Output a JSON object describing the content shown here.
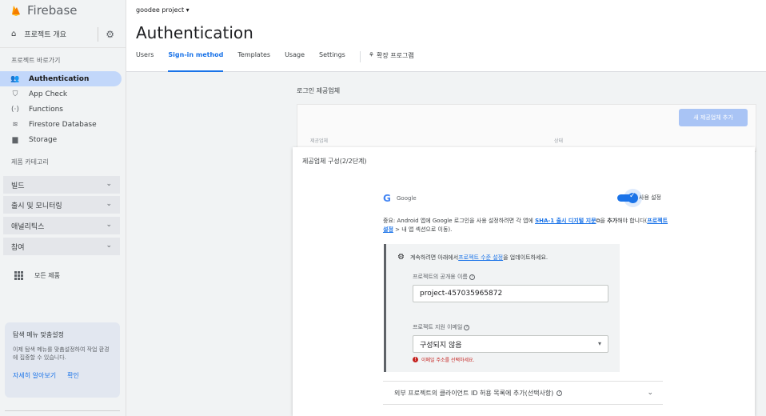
{
  "sidebar": {
    "brand": "Firebase",
    "overview_label": "프로젝트 개요",
    "shortcuts_label": "프로젝트 바로가기",
    "nav_items": [
      {
        "label": "Authentication",
        "icon": "people-icon"
      },
      {
        "label": "App Check",
        "icon": "shield-check-icon"
      },
      {
        "label": "Functions",
        "icon": "functions-icon"
      },
      {
        "label": "Firestore Database",
        "icon": "firestore-icon"
      },
      {
        "label": "Storage",
        "icon": "folder-icon"
      }
    ],
    "categories_label": "제품 카테고리",
    "groups": [
      "빌드",
      "출시 및 모니터링",
      "애널리틱스",
      "참여"
    ],
    "all_products": "모든 제품",
    "promo": {
      "title": "탐색 메뉴 맞춤설정",
      "desc": "이제 탐색 메뉴를 맞춤설정하여 작업 환경에 집중할 수 있습니다.",
      "learn_more": "자세히 알아보기",
      "confirm": "확인"
    }
  },
  "header": {
    "project": "goodee project",
    "title": "Authentication",
    "tabs": [
      "Users",
      "Sign-in method",
      "Templates",
      "Usage",
      "Settings",
      "확장 프로그램"
    ]
  },
  "providers": {
    "label": "로그인 제공업체",
    "add_button": "새 제공업체 추가",
    "col_provider": "제공업체",
    "col_status": "상태"
  },
  "config": {
    "heading": "제공업체 구성(2/2단계)",
    "google_name": "Google",
    "toggle_label": "사용 설정",
    "note": {
      "prefix": "중요: Android 앱에 Google 로그인을 사용 설정하려면 각 앱에 ",
      "link1": "SHA-1 출시 디지털 지문",
      "mid": "을 ",
      "bold": "추가",
      "mid2": "해야 합니다(",
      "link2": "프로젝트 설정",
      "suffix": " > 내 앱 섹션으로 이동)."
    },
    "panel": {
      "heading_prefix": "계속하려면 아래에서 ",
      "heading_link": "프로젝트 수준 설정",
      "heading_suffix": "을 업데이트하세요.",
      "public_name_label": "프로젝트의 공개용 이름",
      "public_name_value": "project-457035965872",
      "support_email_label": "프로젝트 지원 이메일",
      "support_email_value": "구성되지 않음",
      "error": "이메일 주소를 선택하세요."
    },
    "accordion": "외부 프로젝트의 클라이언트 ID 허용 목록에 추가(선택사항)"
  },
  "colors": {
    "accent": "#1a73e8",
    "active_nav": "#c2d7fa",
    "error": "#c5221f"
  }
}
